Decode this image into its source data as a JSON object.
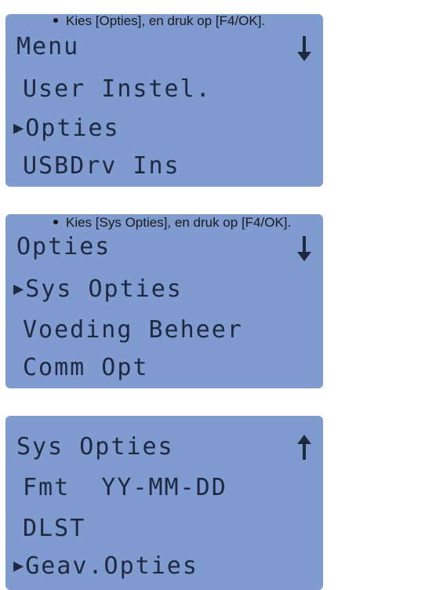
{
  "colors": {
    "lcd_background": "#7f9bd0",
    "lcd_text": "#1e2940"
  },
  "instructions": [
    "Kies [Opties], en druk op [F4/OK].",
    "Kies [Sys Opties], en druk op [F4/OK]."
  ],
  "screens": [
    {
      "title": "Menu",
      "scroll_indicator": "down-arrow-icon",
      "items": [
        {
          "label": "User Instel.",
          "selected": false
        },
        {
          "label": "Opties",
          "selected": true
        },
        {
          "label": "USBDrv Ins",
          "selected": false
        }
      ]
    },
    {
      "title": "Opties",
      "scroll_indicator": "down-arrow-icon",
      "items": [
        {
          "label": "Sys Opties",
          "selected": true
        },
        {
          "label": "Voeding Beheer",
          "selected": false
        },
        {
          "label": "Comm Opt",
          "selected": false
        }
      ]
    },
    {
      "title": "Sys Opties",
      "scroll_indicator": "up-arrow-icon",
      "items": [
        {
          "label": "Fmt  YY-MM-DD",
          "selected": false
        },
        {
          "label": "DLST",
          "selected": false
        },
        {
          "label": "Geav.Opties",
          "selected": true
        }
      ]
    }
  ]
}
